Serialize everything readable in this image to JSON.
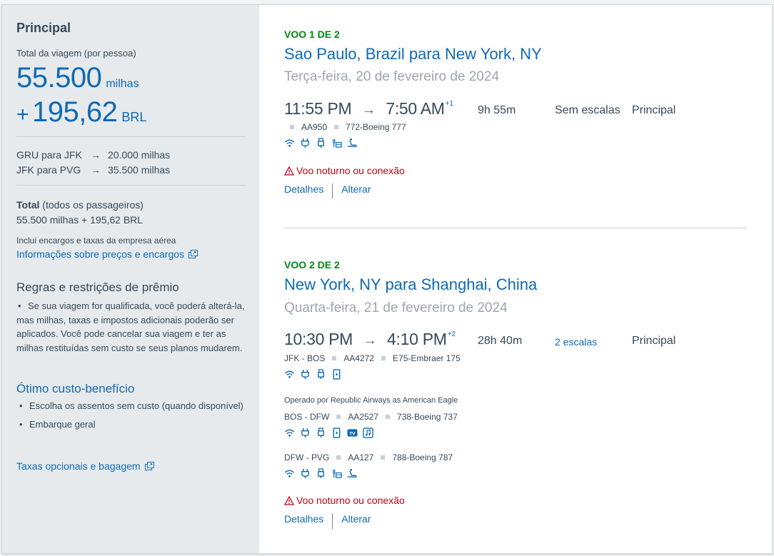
{
  "colors": {
    "accent": "#0f6ab4",
    "green": "#008712",
    "warning": "#c30019",
    "sidebar_bg": "#e6eaec"
  },
  "sidebar": {
    "title": "Principal",
    "subtitle": "Total da viagem (por pessoa)",
    "miles_value": "55.500",
    "miles_unit": "milhas",
    "brl_plus": "+",
    "brl_value": "195,62",
    "brl_unit": "BRL",
    "segments": [
      {
        "route": "GRU para JFK",
        "miles": "20.000 milhas"
      },
      {
        "route": "JFK para PVG",
        "miles": "35.500 milhas"
      }
    ],
    "total_label": "Total",
    "total_suffix": " (todos os passageiros)",
    "total_value": "55.500 milhas + 195,62 BRL",
    "fees_note": "Inclui encargos e taxas da empresa aérea",
    "fees_link": "Informações sobre preços e encargos",
    "rules_title": "Regras e restrições de prêmio",
    "rules_text": "Se sua viagem for qualificada, você poderá alterá-la, mas milhas, taxas e impostos adicionais poderão ser aplicados. Você pode cancelar sua viagem e ter as milhas restituídas sem custo se seus planos mudarem.",
    "value_title": "Ótimo custo-benefício",
    "value_items": [
      "Escolha os assentos sem custo (quando disponível)",
      "Embarque geral"
    ],
    "bag_link": "Taxas opcionais e bagagem"
  },
  "flights": [
    {
      "label": "VOO 1 DE 2",
      "route": "Sao Paulo, Brazil para New York, NY",
      "date": "Terça-feira, 20 de fevereiro de 2024",
      "depart": "11:55 PM",
      "arrive": "7:50 AM",
      "day_offset": "+1",
      "duration": "9h 55m",
      "stops": "Sem escalas",
      "cabin": "Principal",
      "segment": {
        "flight": "AA950",
        "aircraft": "772-Boeing 777"
      },
      "warning": "Voo noturno ou conexão",
      "details": "Detalhes",
      "change": "Alterar"
    },
    {
      "label": "VOO 2 DE 2",
      "route": "New York, NY para Shanghai, China",
      "date": "Quarta-feira, 21 de fevereiro de 2024",
      "depart": "10:30 PM",
      "arrive": "4:10 PM",
      "day_offset": "+2",
      "duration": "28h 40m",
      "stops": "2 escalas",
      "cabin": "Principal",
      "segments": [
        {
          "route": "JFK - BOS",
          "flight": "AA4272",
          "aircraft": "E75-Embraer 175"
        },
        {
          "route": "BOS - DFW",
          "flight": "AA2527",
          "aircraft": "738-Boeing 737"
        },
        {
          "route": "DFW - PVG",
          "flight": "AA127",
          "aircraft": "788-Boeing 787"
        }
      ],
      "operated_by": "Operado por Republic Airways as American Eagle",
      "tv_badge": "TV",
      "warning": "Voo noturno ou conexão",
      "details": "Detalhes",
      "change": "Alterar"
    }
  ]
}
